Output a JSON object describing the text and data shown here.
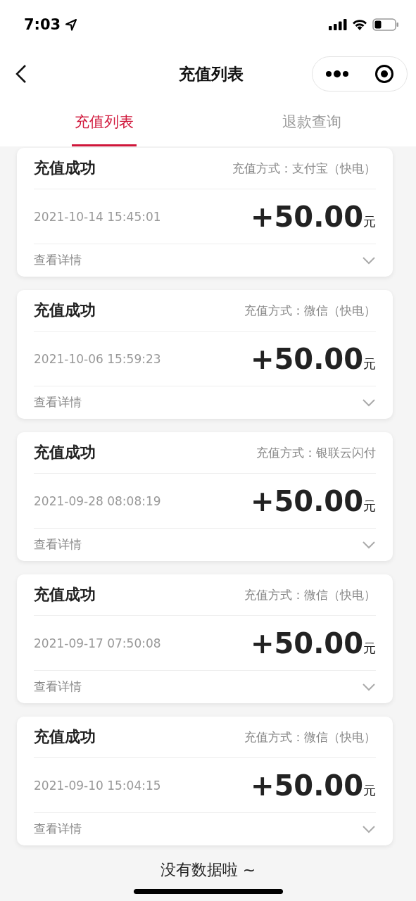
{
  "status_bar": {
    "time": "7:03"
  },
  "nav": {
    "title": "充值列表"
  },
  "tabs": [
    {
      "label": "充值列表",
      "selected": true
    },
    {
      "label": "退款查询",
      "selected": false
    }
  ],
  "records": [
    {
      "status": "充值成功",
      "method": "充值方式：支付宝（快电）",
      "time": "2021-10-14 15:45:01",
      "amount": "+50.00",
      "unit": "元",
      "details": "查看详情",
      "expanded": false
    },
    {
      "status": "充值成功",
      "method": "充值方式：微信（快电）",
      "time": "2021-10-06 15:59:23",
      "amount": "+50.00",
      "unit": "元",
      "details": "查看详情",
      "expanded": false
    },
    {
      "status": "充值成功",
      "method": "充值方式：银联云闪付",
      "time": "2021-09-28 08:08:19",
      "amount": "+50.00",
      "unit": "元",
      "details": "查看详情",
      "expanded": false
    },
    {
      "status": "充值成功",
      "method": "充值方式：微信（快电）",
      "time": "2021-09-17 07:50:08",
      "amount": "+50.00",
      "unit": "元",
      "details": "查看详情",
      "expanded": false
    },
    {
      "status": "充值成功",
      "method": "充值方式：微信（快电）",
      "time": "2021-09-10 15:04:15",
      "amount": "+50.00",
      "unit": "元",
      "details": "查看详情",
      "expanded": false
    }
  ],
  "footer": {
    "text": "没有数据啦 ~"
  }
}
